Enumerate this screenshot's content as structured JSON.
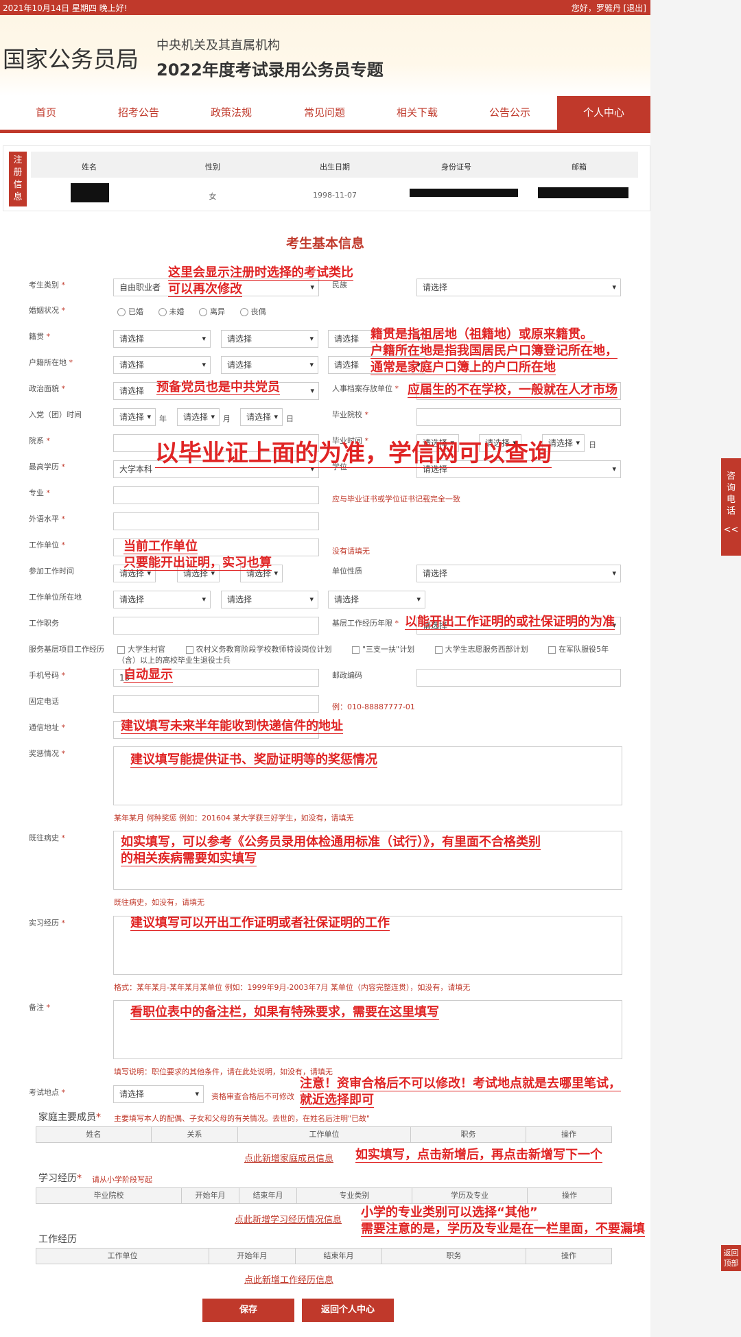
{
  "topbar": {
    "date": "2021年10月14日  星期四  晚上好!",
    "greeting": "您好，罗雅丹  [退出]"
  },
  "header": {
    "site": "国家公务员局",
    "sub1": "中央机关及其直属机构",
    "sub2": "2022年度考试录用公务员专题"
  },
  "nav": [
    "首页",
    "招考公告",
    "政策法规",
    "常见问题",
    "相关下载",
    "公告公示",
    "个人中心"
  ],
  "register": {
    "tag": "注册信息",
    "cols": [
      "姓名",
      "性别",
      "出生日期",
      "身份证号",
      "邮箱"
    ],
    "gender": "女",
    "birth": "1998-11-07"
  },
  "section_title": "考生基本信息",
  "labels": {
    "kslb": "考生类别",
    "hyzk": "婚姻状况",
    "jg": "籍贯",
    "hjszd": "户籍所在地",
    "zzmm": "政治面貌",
    "rdsj": "入党（团）时间",
    "yx": "院系",
    "zgxl": "最高学历",
    "zy": "专业",
    "wyspl": "外语水平",
    "gzdw": "工作单位",
    "cjgzsj": "参加工作时间",
    "gzdwszd": "工作单位所在地",
    "gzzw": "工作职务",
    "fwjc": "服务基层项目工作经历",
    "sjhm": "手机号码",
    "gddh": "固定电话",
    "txdz": "通信地址",
    "jcqk": "奖惩情况",
    "jwbs": "既往病史",
    "sxjl": "实习经历",
    "bz": "备注",
    "ksdd": "考试地点",
    "mz": "民族",
    "rsda": "人事档案存放单位",
    "byyx": "毕业院校",
    "bysj": "毕业时间",
    "xw": "学位",
    "dwxz": "单位性质",
    "jcgznx": "基层工作经历年限",
    "yzbm": "邮政编码"
  },
  "values": {
    "kslb": "自由职业者",
    "zgxl": "大学本科",
    "sjhm": "13",
    "select": "请选择"
  },
  "units": {
    "year": "年",
    "month": "月",
    "day": "日"
  },
  "marriage": [
    "已婚",
    "未婚",
    "离异",
    "丧偶"
  ],
  "service": [
    "大学生村官",
    "农村义务教育阶段学校教师特设岗位计划",
    "\"三支一扶\"计划",
    "大学生志愿服务西部计划",
    "在军队服役5年（含）以上的高校毕业生退役士兵"
  ],
  "hints": {
    "zy": "应与毕业证书或学位证书记载完全一致",
    "gzdw": "没有请填无",
    "gddh": "例：010-88887777-01",
    "jcqk": "某年某月 何种奖惩 例如：201604 某大学获三好学生，如没有，请填无",
    "jwbs": "既往病史，如没有，请填无",
    "sxjl": "格式：某年某月-某年某月某单位 例如：1999年9月-2003年7月 某单位（内容完整连贯），如没有，请填无",
    "bz": "填写说明：职位要求的其他条件，请在此处说明，如没有，请填无",
    "ksdd": "资格审查合格后不可修改"
  },
  "family": {
    "title": "家庭主要成员",
    "note": "主要填写本人的配偶、子女和父母的有关情况。去世的，在姓名后注明\"已故\"",
    "cols": [
      "姓名",
      "关系",
      "工作单位",
      "职务",
      "操作"
    ],
    "link": "点此新增家庭成员信息"
  },
  "study": {
    "title": "学习经历",
    "note": "请从小学阶段写起",
    "cols": [
      "毕业院校",
      "开始年月",
      "结束年月",
      "专业类别",
      "学历及专业",
      "操作"
    ],
    "link": "点此新增学习经历情况信息"
  },
  "work": {
    "title": "工作经历",
    "cols": [
      "工作单位",
      "开始年月",
      "结束年月",
      "职务",
      "操作"
    ],
    "link": "点此新增工作经历信息"
  },
  "buttons": {
    "save": "保存",
    "back": "返回个人中心"
  },
  "side": {
    "consult": "咨询电话",
    "arrow": "<<",
    "top": "返回顶部"
  },
  "annotations": {
    "a1": "这里会显示注册时选择的考试类比",
    "a2": "可以再次修改",
    "a3": "籍贯是指祖居地（祖籍地）或原来籍贯。",
    "a4": "户籍所在地是指我国居民户口簿登记所在地，",
    "a5": "通常是家庭户口簿上的户口所在地",
    "a6": "预备党员也是中共党员",
    "a7": "应届生的不在学校，一般就在人才市场",
    "a8": "以毕业证上面的为准，学信网可以查询",
    "a9": "当前工作单位",
    "a10": "只要能开出证明，实习也算",
    "a11": "以能开出工作证明的或社保证明的为准",
    "a12": "自动显示",
    "a13": "建议填写未来半年能收到快递信件的地址",
    "a14": "建议填写能提供证书、奖励证明等的奖惩情况",
    "a15": "如实填写，可以参考《公务员录用体检通用标准（试行）》，有里面不合格类别",
    "a16": "的相关疾病需要如实填写",
    "a17": "建议填写可以开出工作证明或者社保证明的工作",
    "a18": "看职位表中的备注栏，如果有特殊要求，需要在这里填写",
    "a19": "注意！资审合格后不可以修改！考试地点就是去哪里笔试，",
    "a20": "就近选择即可",
    "a21": "如实填写，点击新增后，再点击新增写下一个",
    "a22": "小学的专业类别可以选择“其他”",
    "a23": "需要注意的是，学历及专业是在一栏里面，不要漏填"
  },
  "colors": {
    "brand": "#c0392b",
    "annotation": "#e02424"
  }
}
